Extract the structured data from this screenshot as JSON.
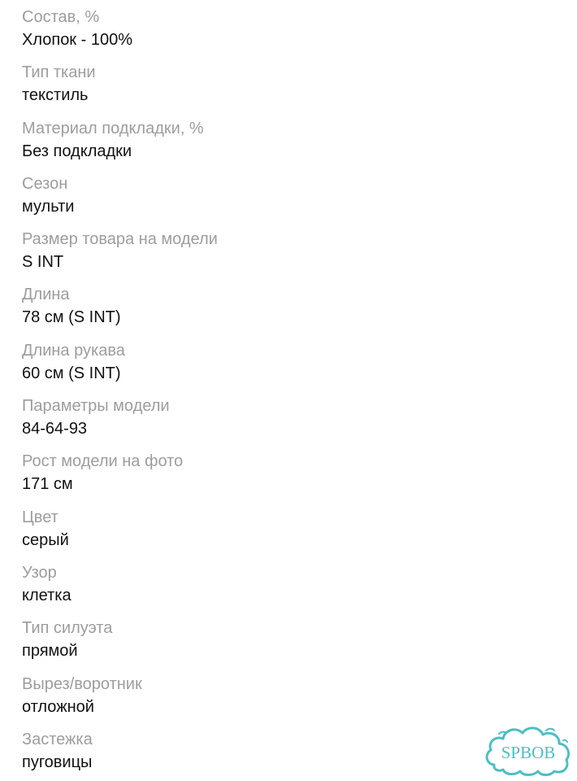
{
  "specs": [
    {
      "label": "Состав, %",
      "value": "Хлопок - 100%"
    },
    {
      "label": "Тип ткани",
      "value": "текстиль"
    },
    {
      "label": "Материал подкладки, %",
      "value": "Без подкладки"
    },
    {
      "label": "Сезон",
      "value": "мульти"
    },
    {
      "label": "Размер товара на модели",
      "value": "S INT"
    },
    {
      "label": "Длина",
      "value": "78 см (S INT)"
    },
    {
      "label": "Длина рукава",
      "value": "60 см (S INT)"
    },
    {
      "label": "Параметры модели",
      "value": "84-64-93"
    },
    {
      "label": "Рост модели на фото",
      "value": "171 см"
    },
    {
      "label": "Цвет",
      "value": "серый"
    },
    {
      "label": "Узор",
      "value": "клетка"
    },
    {
      "label": "Тип силуэта",
      "value": "прямой"
    },
    {
      "label": "Вырез/воротник",
      "value": "отложной"
    },
    {
      "label": "Застежка",
      "value": "пуговицы"
    }
  ],
  "watermark": {
    "text": "SPBOB",
    "color": "#4bbfc3"
  },
  "colors": {
    "label": "#9d9d9d",
    "value": "#111111",
    "background": "#ffffff"
  }
}
